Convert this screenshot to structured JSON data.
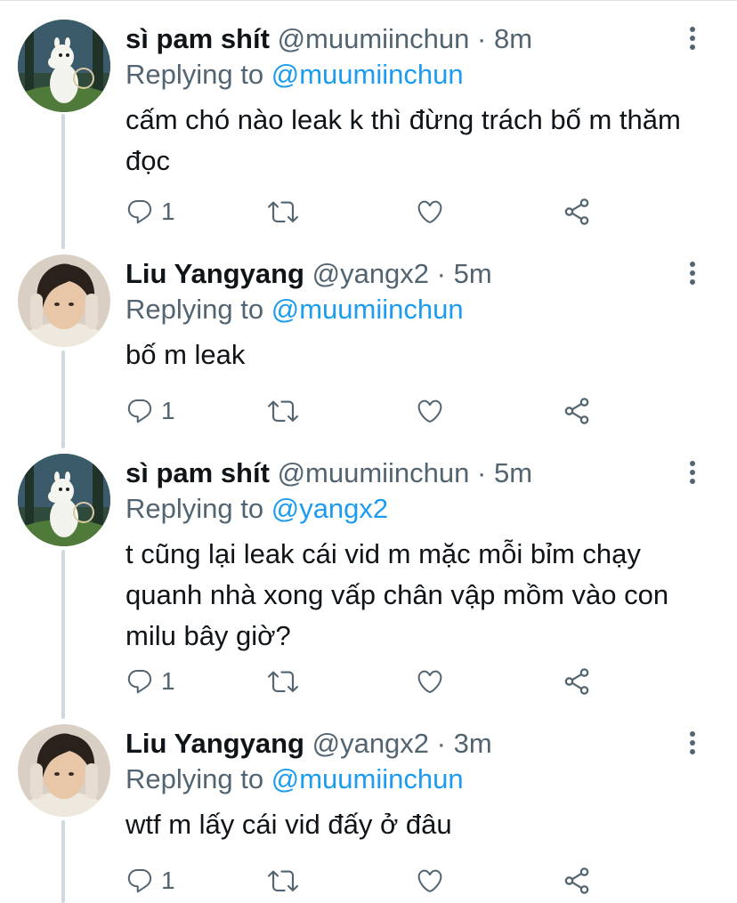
{
  "colors": {
    "accent": "#1d9bf0",
    "text": "#0f1419",
    "secondary": "#536471",
    "thread_line": "#cfd9de"
  },
  "tweets": [
    {
      "display_name": "sì pam shít",
      "handle": "@muumiinchun",
      "separator": "·",
      "time": "8m",
      "replying_prefix": "Replying to",
      "replying_to": "@muumiinchun",
      "text": "cấm chó nào leak k thì đừng trách bố m thăm đọc",
      "reply_count": "1",
      "avatar": "moomin-avatar"
    },
    {
      "display_name": "Liu Yangyang",
      "handle": "@yangx2",
      "separator": "·",
      "time": "5m",
      "replying_prefix": "Replying to",
      "replying_to": "@muumiinchun",
      "text": "bố m leak",
      "reply_count": "1",
      "avatar": "person-avatar"
    },
    {
      "display_name": "sì pam shít",
      "handle": "@muumiinchun",
      "separator": "·",
      "time": "5m",
      "replying_prefix": "Replying to",
      "replying_to": "@yangx2",
      "text": "t cũng lại leak cái vid m mặc mỗi bỉm chạy quanh nhà xong vấp chân vập mồm vào con milu bây giờ?",
      "reply_count": "1",
      "avatar": "moomin-avatar"
    },
    {
      "display_name": "Liu Yangyang",
      "handle": "@yangx2",
      "separator": "·",
      "time": "3m",
      "replying_prefix": "Replying to",
      "replying_to": "@muumiinchun",
      "text": "wtf m lấy cái vid đấy ở đâu",
      "reply_count": "1",
      "avatar": "person-avatar"
    }
  ]
}
